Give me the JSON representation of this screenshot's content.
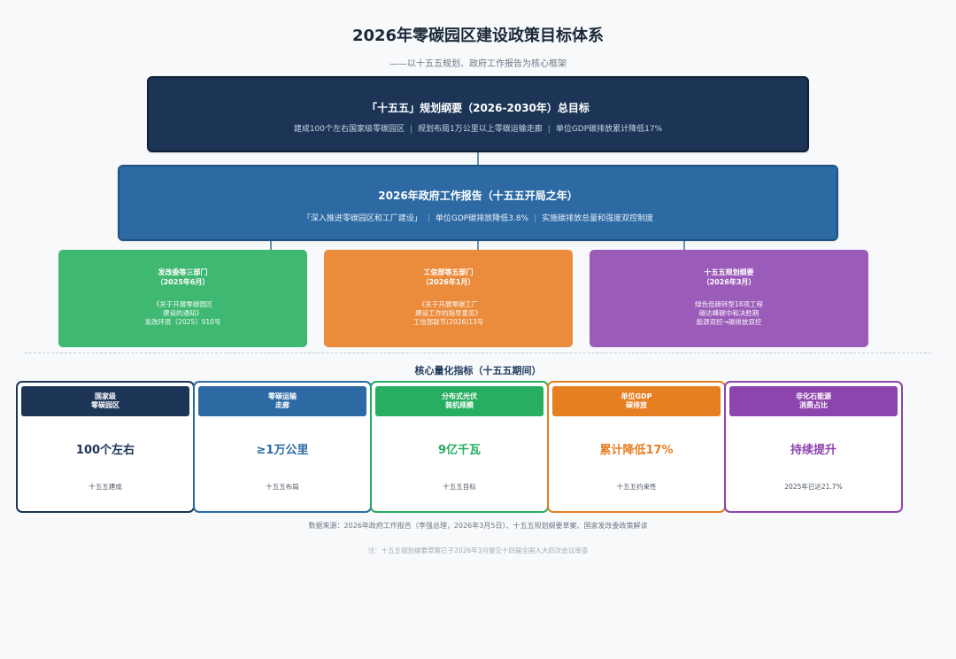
{
  "title": "2026年零碳园区建设政策目标体系",
  "subtitle": "——以十五五规划、政府工作报告为核心框架",
  "plan_box": {
    "title": "「十五五」规划纲要（2026-2030年）总目标",
    "items": [
      "建成100个左右国家级零碳园区",
      "规划布局1万公里以上零碳运输走廊",
      "单位GDP碳排放累计降低17%"
    ]
  },
  "report_box": {
    "title": "2026年政府工作报告（十五五开局之年）",
    "items": [
      "「深入推进零碳园区和工厂建设」",
      "单位GDP碳排放降低3.8%",
      "实施碳排放总量和强度双控制度"
    ]
  },
  "departments": [
    {
      "name": "发改委等三部门",
      "date": "（2025年6月）",
      "lines": [
        "《关于开展零碳园区",
        "建设的通知》",
        "发改环资〔2025〕910号"
      ],
      "color": "#3fb871"
    },
    {
      "name": "工信部等五部门",
      "date": "（2026年1月）",
      "lines": [
        "《关于开展零碳工厂",
        "建设工作的指导意见》",
        "工信部联节(2026)13号"
      ],
      "color": "#eb8b3c"
    },
    {
      "name": "十五五规划纲要",
      "date": "（2026年3月）",
      "lines": [
        "绿色低碳转型18项工程",
        "碳达峰碳中和决胜期",
        "能源双控→碳排放双控"
      ],
      "color": "#9b5bb8"
    }
  ],
  "kpi_heading": "核心量化指标（十五五期间）",
  "kpis": [
    {
      "label_1": "国家级",
      "label_2": "零碳园区",
      "value": "100个左右",
      "note": "十五五建成",
      "color": "#1c3557"
    },
    {
      "label_1": "零碳运输",
      "label_2": "走廊",
      "value": "≥1万公里",
      "note": "十五五布局",
      "color": "#2d6aa4"
    },
    {
      "label_1": "分布式光伏",
      "label_2": "装机规模",
      "value": "9亿千瓦",
      "note": "十五五目标",
      "color": "#27ae60"
    },
    {
      "label_1": "单位GDP",
      "label_2": "碳排放",
      "value": "累计降低17%",
      "note": "十五五约束性",
      "color": "#e67e22"
    },
    {
      "label_1": "非化石能源",
      "label_2": "消费占比",
      "value": "持续提升",
      "note": "2025年已达21.7%",
      "color": "#8e44ad"
    }
  ],
  "source": "数据来源：2026年政府工作报告（李强总理，2026年3月5日）、十五五规划纲要草案、国家发改委政策解读",
  "footnote": "注：十五五规划纲要草案已于2026年3月提交十四届全国人大四次会议审查"
}
